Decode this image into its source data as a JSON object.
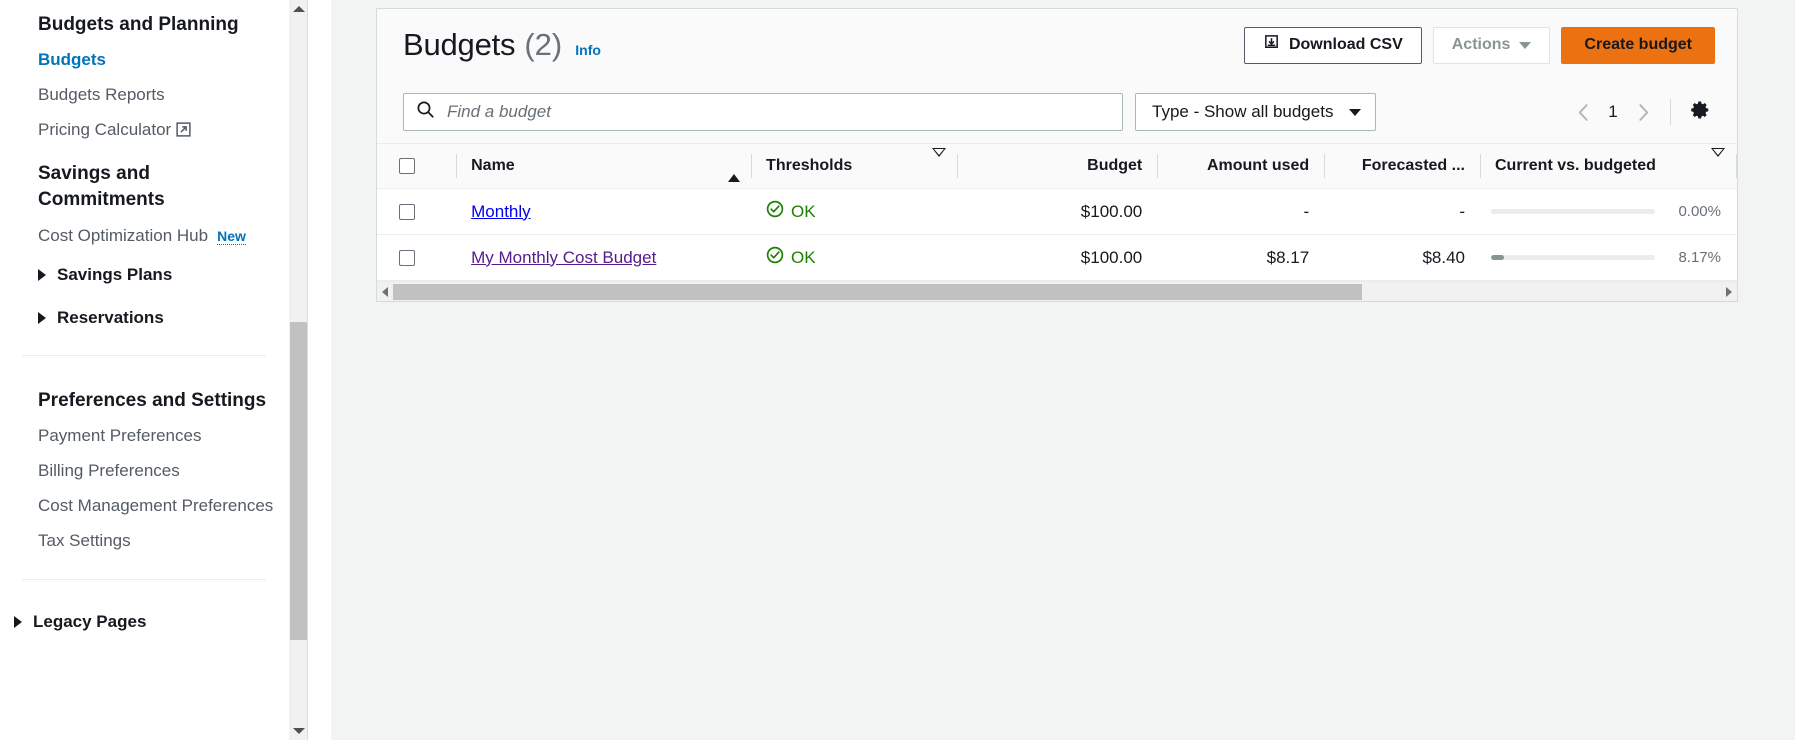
{
  "sidebar": {
    "sections": [
      {
        "title": "Budgets and Planning",
        "items": [
          {
            "label": "Budgets",
            "active": true,
            "external": false
          },
          {
            "label": "Budgets Reports",
            "active": false,
            "external": false
          },
          {
            "label": "Pricing Calculator",
            "active": false,
            "external": true
          }
        ]
      },
      {
        "title": "Savings and Commitments",
        "title_line1": "Savings and",
        "title_line2": "Commitments",
        "items": [
          {
            "label": "Cost Optimization Hub",
            "badge": "New"
          }
        ],
        "expandables": [
          {
            "label": "Savings Plans"
          },
          {
            "label": "Reservations"
          }
        ]
      },
      {
        "title": "Preferences and Settings",
        "items": [
          {
            "label": "Payment Preferences"
          },
          {
            "label": "Billing Preferences"
          },
          {
            "label": "Cost Management Preferences"
          },
          {
            "label": "Tax Settings"
          }
        ]
      }
    ],
    "legacy": {
      "label": "Legacy Pages"
    }
  },
  "header": {
    "title": "Budgets",
    "count": "(2)",
    "info_label": "Info",
    "download_csv_label": "Download CSV",
    "actions_label": "Actions",
    "create_budget_label": "Create budget"
  },
  "filters": {
    "search_placeholder": "Find a budget",
    "search_value": "",
    "type_filter_label": "Type - Show all budgets",
    "page_number": "1"
  },
  "table": {
    "columns": [
      {
        "key": "check",
        "label": "",
        "sort": "none",
        "align": "left"
      },
      {
        "key": "name",
        "label": "Name",
        "sort": "asc",
        "align": "left"
      },
      {
        "key": "thresh",
        "label": "Thresholds",
        "sort": "idle",
        "align": "left"
      },
      {
        "key": "budget",
        "label": "Budget",
        "sort": "none",
        "align": "right"
      },
      {
        "key": "used",
        "label": "Amount used",
        "sort": "none",
        "align": "right"
      },
      {
        "key": "fcast",
        "label": "Forecasted ...",
        "sort": "none",
        "align": "right"
      },
      {
        "key": "curvsb",
        "label": "Current vs. budgeted",
        "sort": "idle",
        "align": "left"
      }
    ],
    "rows": [
      {
        "name": "Monthly",
        "visited": false,
        "threshold_status": "OK",
        "budget": "$100.00",
        "amount_used": "-",
        "forecasted": "-",
        "percent_label": "0.00%",
        "percent_value": 0
      },
      {
        "name": "My Monthly Cost Budget",
        "visited": true,
        "threshold_status": "OK",
        "budget": "$100.00",
        "amount_used": "$8.17",
        "forecasted": "$8.40",
        "percent_label": "8.17%",
        "percent_value": 8.17
      }
    ]
  },
  "colors": {
    "accent_orange": "#ec7211",
    "link_blue": "#0073bb",
    "status_green": "#1d8102",
    "visited_purple": "#551a8b"
  }
}
